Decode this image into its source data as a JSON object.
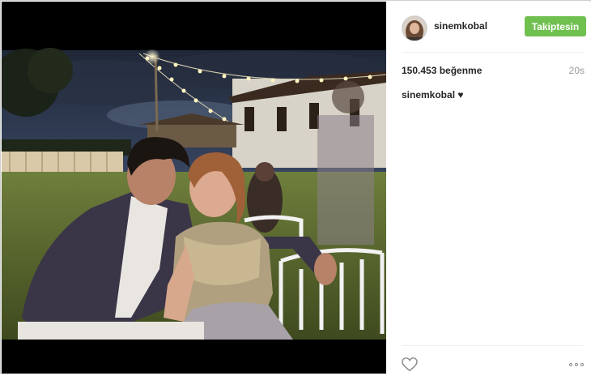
{
  "post": {
    "username": "sinemkobal",
    "follow_label": "Takiptesin",
    "likes": "150.453 beğenme",
    "time": "20s",
    "caption_user": "sinemkobal",
    "caption_text": "♥"
  },
  "icons": {
    "like": "heart-outline-icon",
    "more": "ellipsis-icon"
  },
  "colors": {
    "follow_button": "#70c050",
    "photo_letterbox": "#000000"
  }
}
